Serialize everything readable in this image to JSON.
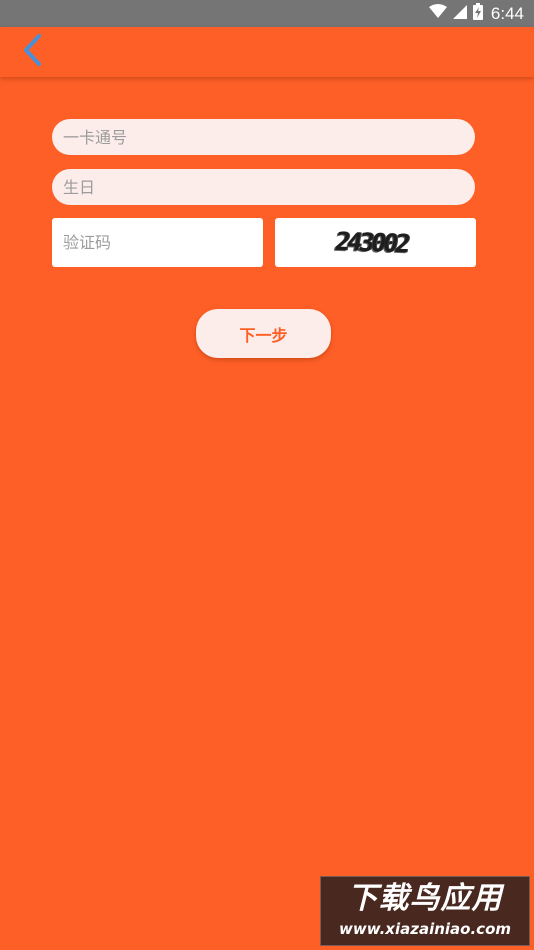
{
  "status_bar": {
    "time": "6:44",
    "icons": [
      "wifi-icon",
      "cell-signal-icon",
      "battery-charging-icon"
    ]
  },
  "app_bar": {
    "back_icon": "chevron-left-icon",
    "back_icon_color": "#4A90D9"
  },
  "form": {
    "card_number": {
      "value": "",
      "placeholder": "一卡通号"
    },
    "birthday": {
      "value": "",
      "placeholder": "生日"
    },
    "verification_code": {
      "value": "",
      "placeholder": "验证码"
    },
    "captcha_text": "243002",
    "next_label": "下一步"
  },
  "watermark": {
    "title": "下载鸟应用",
    "url": "www.xiazainiao.com"
  },
  "colors": {
    "background": "#FE5F26",
    "status_bar": "#757575",
    "field_bg": "#FCEDEA",
    "accent": "#FE5F26"
  }
}
